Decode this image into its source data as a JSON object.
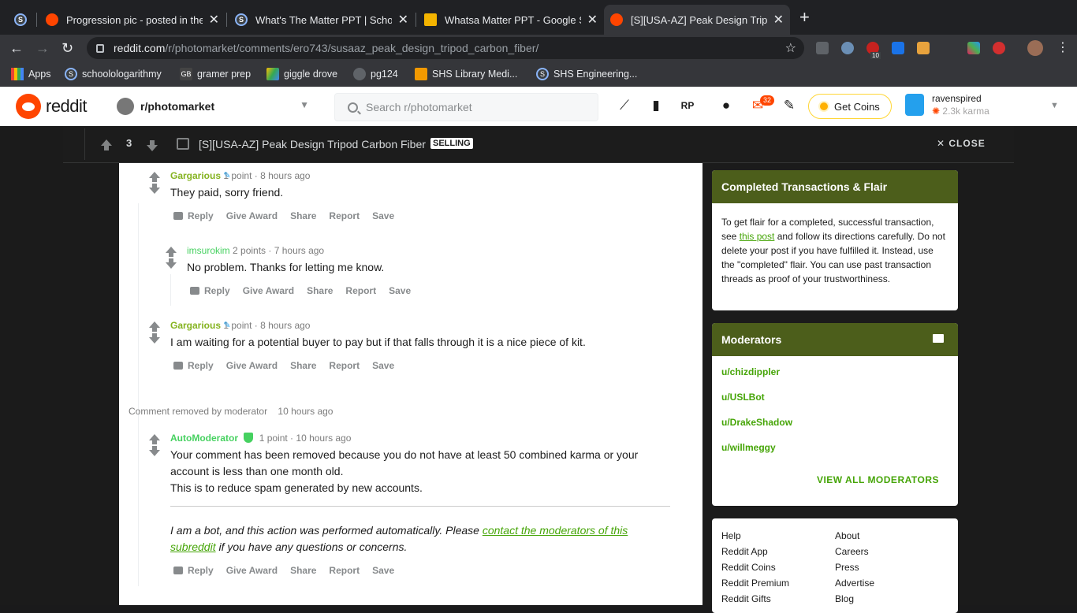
{
  "browser": {
    "tabs": [
      {
        "title": "",
        "favicon": "s-icon",
        "color": "#3c4043"
      },
      {
        "title": "Progression pic - posted in the",
        "favicon": "reddit-icon",
        "color": "#ff4500"
      },
      {
        "title": "What's The Matter PPT | Schoo",
        "favicon": "s-icon",
        "color": "#3c4043"
      },
      {
        "title": "Whatsa Matter PPT - Google Sl",
        "favicon": "slides-icon",
        "color": "#f4b400"
      },
      {
        "title": "[S][USA-AZ] Peak Design Tripo",
        "favicon": "reddit-icon",
        "color": "#ff4500"
      }
    ],
    "url_domain": "reddit.com",
    "url_path": "/r/photomarket/comments/ero743/susaaz_peak_design_tripod_carbon_fiber/",
    "ext_badge": "10",
    "bookmarks": [
      {
        "label": "Apps"
      },
      {
        "label": "schoolologarithmy"
      },
      {
        "label": "gramer prep"
      },
      {
        "label": "giggle drove"
      },
      {
        "label": "pg124"
      },
      {
        "label": "SHS Library Medi..."
      },
      {
        "label": "SHS Engineering..."
      }
    ]
  },
  "header": {
    "logo": "reddit",
    "subreddit": "r/photomarket",
    "search_placeholder": "Search r/photomarket",
    "notif_count": "32",
    "coins_label": "Get Coins",
    "username": "ravenspired",
    "karma": "2.3k karma"
  },
  "post": {
    "votes": "3",
    "title": "[S][USA-AZ] Peak Design Tripod Carbon Fiber",
    "flair": "SELLING",
    "close_label": "CLOSE"
  },
  "comments": [
    {
      "author": "Gargarious",
      "points": "1 point",
      "time": "8 hours ago",
      "body": "They paid, sorry friend."
    },
    {
      "author": "imsurokim",
      "points": "2 points",
      "time": "7 hours ago",
      "body": "No problem. Thanks for letting me know."
    },
    {
      "author": "Gargarious",
      "points": "1 point",
      "time": "8 hours ago",
      "body": "I am waiting for a potential buyer to pay but if that falls through it is a nice piece of kit."
    },
    {
      "author": "AutoModerator",
      "points": "1 point",
      "time": "10 hours ago",
      "body1": "Your comment has been removed because you do not have at least 50 combined karma or your account is less than one month old.",
      "body2": "This is to reduce spam generated by new accounts.",
      "note_pre": "I am a bot, and this action was performed automatically. Please ",
      "note_link": "contact the moderators of this subreddit",
      "note_post": " if you have any questions or concerns."
    }
  ],
  "removed": {
    "label": "Comment removed by moderator",
    "time": "10 hours ago"
  },
  "actions": {
    "reply": "Reply",
    "award": "Give Award",
    "share": "Share",
    "report": "Report",
    "save": "Save"
  },
  "sidebar": {
    "flair_title": "Completed Transactions & Flair",
    "flair_pre": "To get flair for a completed, successful transaction, see ",
    "flair_link": "this post",
    "flair_post": " and follow its directions carefully. Do not delete your post if you have fulfilled it. Instead, use the \"completed\" flair. You can use past transaction threads as proof of your trustworthiness.",
    "mods_title": "Moderators",
    "mods": [
      "u/chizdippler",
      "u/USLBot",
      "u/DrakeShadow",
      "u/willmeggy"
    ],
    "view_all": "VIEW ALL MODERATORS"
  },
  "footer": {
    "col1": [
      "Help",
      "Reddit App",
      "Reddit Coins",
      "Reddit Premium",
      "Reddit Gifts"
    ],
    "col2": [
      "About",
      "Careers",
      "Press",
      "Advertise",
      "Blog"
    ]
  }
}
